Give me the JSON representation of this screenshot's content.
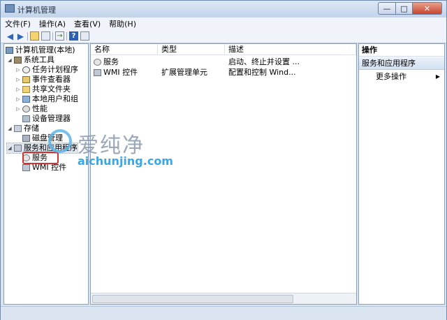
{
  "window": {
    "title": "计算机管理",
    "controls": {
      "minimize": "—",
      "maximize": "□",
      "close": "✕"
    }
  },
  "menu": [
    "文件(F)",
    "操作(A)",
    "查看(V)",
    "帮助(H)"
  ],
  "toolbar": [
    "back-icon",
    "forward-icon",
    "up-folder-icon",
    "show-hide-tree-icon",
    "export-icon",
    "help-icon",
    "properties-icon"
  ],
  "tree": {
    "root": "计算机管理(本地)",
    "system_tools": "系统工具",
    "task_scheduler": "任务计划程序",
    "event_viewer": "事件查看器",
    "shared_folders": "共享文件夹",
    "local_users": "本地用户和组",
    "performance": "性能",
    "device_manager": "设备管理器",
    "storage": "存储",
    "disk_management": "磁盘管理",
    "services_apps": "服务和应用程序",
    "services": "服务",
    "wmi": "WMI 控件"
  },
  "list": {
    "columns": [
      "名称",
      "类型",
      "描述"
    ],
    "rows": [
      {
        "name": "服务",
        "type": "",
        "desc": "启动、终止并设置 ..."
      },
      {
        "name": "WMI 控件",
        "type": "扩展管理单元",
        "desc": "配置和控制 Wind..."
      }
    ]
  },
  "actions": {
    "title": "操作",
    "section": "服务和应用程序",
    "more": "更多操作"
  },
  "watermark": {
    "cn": "爱纯净",
    "en": "aichunjing.com"
  },
  "colors": {
    "accent": "#3aa6e6",
    "highlight_box": "#d0342c"
  }
}
